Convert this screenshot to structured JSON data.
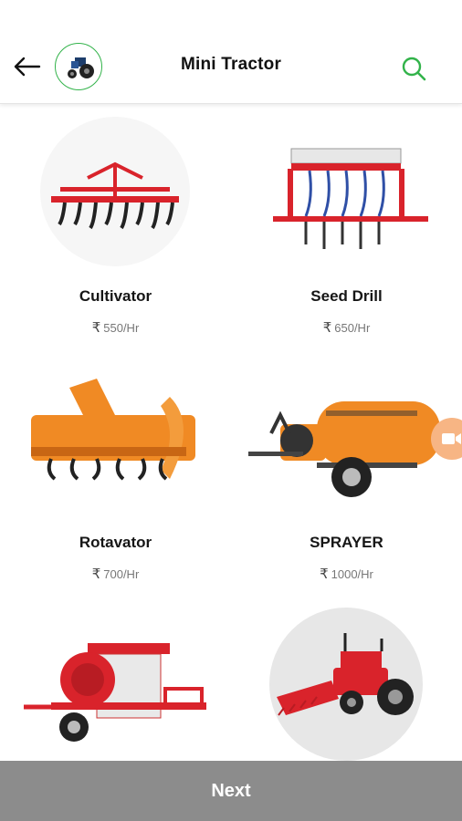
{
  "header": {
    "title": "Mini Tractor",
    "back_icon": "arrow-left-icon",
    "avatar_icon": "mini-tractor-thumbnail",
    "search_icon": "search-icon",
    "accent_color": "#32b34a"
  },
  "items": [
    {
      "name": "Cultivator",
      "price_symbol": "₹",
      "price": "550/Hr"
    },
    {
      "name": "Seed Drill",
      "price_symbol": "₹",
      "price": "650/Hr"
    },
    {
      "name": "Rotavator",
      "price_symbol": "₹",
      "price": "700/Hr"
    },
    {
      "name": "SPRAYER",
      "price_symbol": "₹",
      "price": "1000/Hr"
    },
    {
      "name": "",
      "price_symbol": "",
      "price": ""
    },
    {
      "name": "",
      "price_symbol": "",
      "price": ""
    }
  ],
  "floating_button": {
    "icon": "video-camera-icon",
    "color": "#f7b584"
  },
  "footer": {
    "next_label": "Next",
    "bar_color": "#8c8c8c"
  }
}
